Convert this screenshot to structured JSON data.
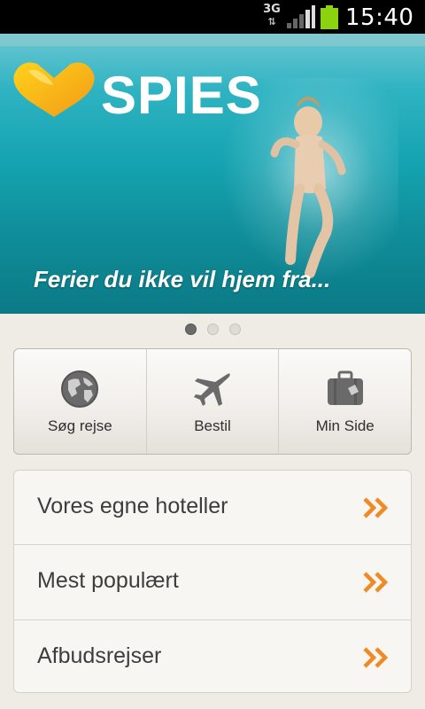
{
  "status_bar": {
    "network": "3G",
    "network_arrows": "⇅",
    "time": "15:40",
    "battery_color": "#8bd30e"
  },
  "hero": {
    "brand": "SPIES",
    "caption": "Ferier du ikke vil hjem fra...",
    "pager": {
      "count": 3,
      "active": 0
    }
  },
  "actions": [
    {
      "label": "Søg rejse",
      "icon": "globe-icon"
    },
    {
      "label": "Bestil",
      "icon": "airplane-icon"
    },
    {
      "label": "Min Side",
      "icon": "suitcase-icon"
    }
  ],
  "menu": [
    {
      "label": "Vores egne hoteller",
      "icon": "double-chevron-right-icon"
    },
    {
      "label": "Mest populært",
      "icon": "double-chevron-right-icon"
    },
    {
      "label": "Afbudsrejser",
      "icon": "double-chevron-right-icon"
    }
  ],
  "colors": {
    "accent": "#f08a24",
    "background": "#efebe5",
    "logo_orange": "#f5a623",
    "logo_yellow": "#ffd21a"
  }
}
